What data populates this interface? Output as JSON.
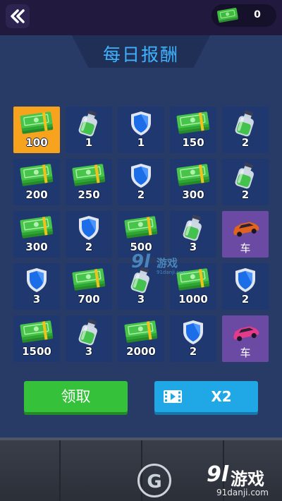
{
  "header": {
    "back_icon": "double-chevron-left-icon",
    "currency_icon": "cash-stack-icon",
    "currency_value": "0"
  },
  "page_title": "每日报酬",
  "colors": {
    "panel": "#283b66",
    "cell": "#1f3970",
    "selected_cell": "#f8a31e",
    "car_cell": "#6a4aa2",
    "cash": "#3dbb3d",
    "shield": "#1c6ee8",
    "potion": "#44c24e",
    "title": "#3fb2ff",
    "claim_button": "#35c23a",
    "double_button": "#1fa7e6"
  },
  "rewards": [
    {
      "type": "cash",
      "icon": "cash-stack-icon",
      "qty": "100",
      "state": "selected"
    },
    {
      "type": "potion",
      "icon": "potion-bottle-icon",
      "qty": "1"
    },
    {
      "type": "shield",
      "icon": "shield-icon",
      "qty": "1"
    },
    {
      "type": "cash",
      "icon": "cash-stack-icon",
      "qty": "150"
    },
    {
      "type": "potion",
      "icon": "potion-bottle-icon",
      "qty": "2"
    },
    {
      "type": "cash",
      "icon": "cash-stack-icon",
      "qty": "200"
    },
    {
      "type": "cash",
      "icon": "cash-stack-icon",
      "qty": "250"
    },
    {
      "type": "shield",
      "icon": "shield-icon",
      "qty": "2"
    },
    {
      "type": "cash",
      "icon": "cash-stack-icon",
      "qty": "300"
    },
    {
      "type": "potion",
      "icon": "potion-bottle-icon",
      "qty": "2"
    },
    {
      "type": "cash",
      "icon": "cash-stack-icon",
      "qty": "300"
    },
    {
      "type": "shield",
      "icon": "shield-icon",
      "qty": "2"
    },
    {
      "type": "cash",
      "icon": "cash-stack-icon",
      "qty": "500"
    },
    {
      "type": "potion",
      "icon": "potion-bottle-icon",
      "qty": "3"
    },
    {
      "type": "car",
      "icon": "orange-car-icon",
      "qty": "车",
      "car_color": "#e0621c"
    },
    {
      "type": "shield",
      "icon": "shield-icon",
      "qty": "3"
    },
    {
      "type": "cash",
      "icon": "cash-stack-icon",
      "qty": "700"
    },
    {
      "type": "potion",
      "icon": "potion-bottle-icon",
      "qty": "3"
    },
    {
      "type": "cash",
      "icon": "cash-stack-icon",
      "qty": "1000"
    },
    {
      "type": "shield",
      "icon": "shield-icon",
      "qty": "2"
    },
    {
      "type": "cash",
      "icon": "cash-stack-icon",
      "qty": "1500"
    },
    {
      "type": "potion",
      "icon": "potion-bottle-icon",
      "qty": "3"
    },
    {
      "type": "cash",
      "icon": "cash-stack-icon",
      "qty": "2000"
    },
    {
      "type": "shield",
      "icon": "shield-icon",
      "qty": "2"
    },
    {
      "type": "car",
      "icon": "pink-car-icon",
      "qty": "车",
      "car_color": "#e43a8c"
    }
  ],
  "buttons": {
    "claim_label": "领取",
    "double_label": "X2",
    "double_icon": "video-ad-icon"
  },
  "watermarks": {
    "center_mark": "9l",
    "center_text": "游戏",
    "center_sub": "91danji.com",
    "bottom_left_mark": "G",
    "bottom_brand_mark": "9l",
    "bottom_brand_text": "游戏",
    "bottom_brand_url": "91danji.com"
  }
}
